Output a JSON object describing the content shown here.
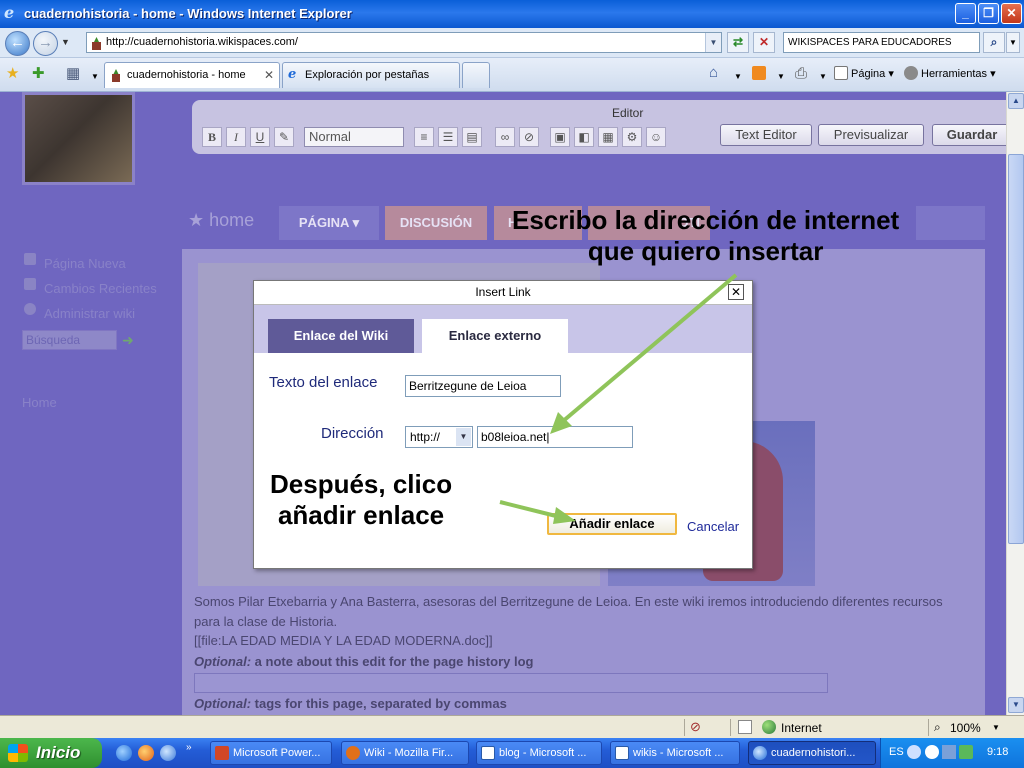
{
  "window": {
    "title": "cuadernohistoria - home - Windows Internet Explorer"
  },
  "address_bar": {
    "url": "http://cuadernohistoria.wikispaces.com/",
    "search_value": "WIKISPACES PARA EDUCADORES"
  },
  "tabs": [
    {
      "label": "cuadernohistoria - home",
      "active": true
    },
    {
      "label": "Exploración por pestañas",
      "active": false
    }
  ],
  "command_bar": {
    "page_label": "Página",
    "tools_label": "Herramientas"
  },
  "editor": {
    "title": "Editor",
    "format_value": "Normal",
    "text_editor_label": "Text Editor",
    "preview_label": "Previsualizar",
    "save_label": "Guardar",
    "bold": "B",
    "italic": "I",
    "underline": "U"
  },
  "site": {
    "home_title": "home",
    "tabs": [
      "PÁGINA ▾",
      "DISCUSIÓN",
      "H",
      "OTI"
    ],
    "sidebar": {
      "new_page": "Página Nueva",
      "recent_changes": "Cambios Recientes",
      "manage_wiki": "Administrar wiki",
      "search_placeholder": "Búsqueda",
      "home": "Home"
    },
    "body_line1": "Somos Pilar Etxebarria y Ana Basterra, asesoras del Berritzegune de Leioa. En este wiki iremos introduciendo diferentes recursos",
    "body_line2": "para la clase de Historia.",
    "body_line3": "[[file:LA EDAD MEDIA Y LA EDAD MODERNA.doc]]",
    "optional1_label": "Optional:",
    "optional1_text": "a note about this edit for the page history log",
    "optional2_label": "Optional:",
    "optional2_text": "tags for this page, separated by commas"
  },
  "dialog": {
    "title": "Insert Link",
    "tab_wiki": "Enlace del Wiki",
    "tab_external": "Enlace externo",
    "text_label": "Texto del enlace",
    "text_value": "Berritzegune de Leioa",
    "address_label": "Dirección",
    "protocol_value": "http://",
    "address_value": "b08leioa.net",
    "add_button": "Añadir enlace",
    "cancel": "Cancelar"
  },
  "annotations": {
    "top_line1": "Escribo la dirección de internet",
    "top_line2": "que quiero insertar",
    "bottom_line1": "Después, clico",
    "bottom_line2": "añadir enlace"
  },
  "status_bar": {
    "zone": "Internet",
    "zoom": "100%"
  },
  "taskbar": {
    "start_label": "Inicio",
    "tasks": [
      {
        "label": "Microsoft Power...",
        "active": false
      },
      {
        "label": "Wiki - Mozilla Fir...",
        "active": false
      },
      {
        "label": "blog - Microsoft ...",
        "active": false
      },
      {
        "label": "wikis - Microsoft ...",
        "active": false
      },
      {
        "label": "cuadernohistori...",
        "active": true
      }
    ],
    "language": "ES",
    "clock": "9:18"
  },
  "colors": {
    "accent_arrow": "#8fc45a",
    "dialog_tab_active": "#5f5a98",
    "overlay": "#6f66c0"
  }
}
